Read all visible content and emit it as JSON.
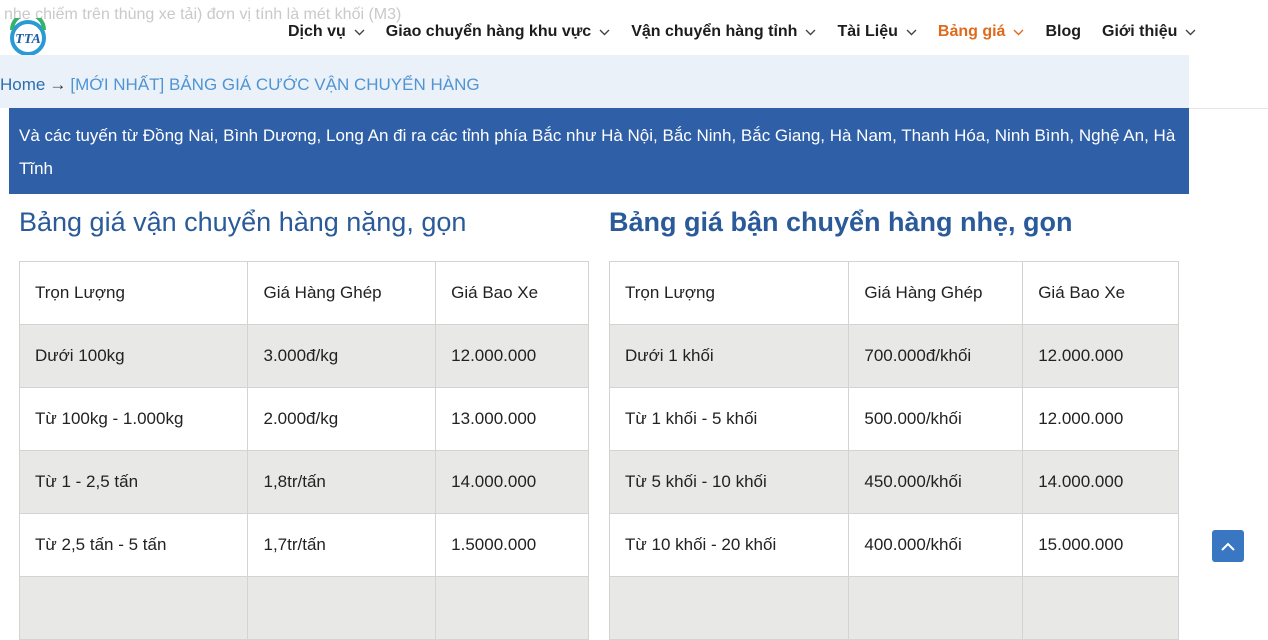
{
  "ghost_text": "nhe chiếm trên thùng xe tải) đơn vị tính là mét khối (M3)",
  "logo": {
    "text": "TTA"
  },
  "nav": [
    {
      "label": "Dịch vụ",
      "dropdown": true,
      "active": false
    },
    {
      "label": "Giao chuyển hàng khu vực",
      "dropdown": true,
      "active": false
    },
    {
      "label": "Vận chuyển hàng tỉnh",
      "dropdown": true,
      "active": false
    },
    {
      "label": "Tài Liệu",
      "dropdown": true,
      "active": false
    },
    {
      "label": "Bảng giá",
      "dropdown": true,
      "active": true
    },
    {
      "label": "Blog",
      "dropdown": false,
      "active": false
    },
    {
      "label": "Giới thiệu",
      "dropdown": true,
      "active": false
    }
  ],
  "breadcrumb": {
    "home": "Home",
    "separator": "→",
    "current": "[MỚI NHẤT] BẢNG GIÁ CƯỚC VẬN CHUYỂN HÀNG"
  },
  "banner": {
    "text": "Và các tuyến từ Đồng Nai, Bình Dương, Long An đi ra các tỉnh phía Bắc như Hà Nội, Bắc Ninh, Bắc Giang, Hà Nam, Thanh Hóa, Ninh Bình, Nghệ An, Hà Tĩnh"
  },
  "heavy": {
    "title": "Bảng giá vận chuyển hàng nặng, gọn",
    "headers": [
      "Trọn Lượng",
      "Giá Hàng Ghép",
      "Giá Bao Xe"
    ],
    "rows": [
      [
        "Dưới 100kg",
        "3.000đ/kg",
        "12.000.000"
      ],
      [
        "Từ 100kg - 1.000kg",
        "2.000đ/kg",
        "13.000.000"
      ],
      [
        "Từ 1 - 2,5 tấn",
        "1,8tr/tấn",
        "14.000.000"
      ],
      [
        "Từ 2,5 tấn - 5 tấn",
        "1,7tr/tấn",
        "1.5000.000"
      ]
    ]
  },
  "light": {
    "title": "Bảng giá bận chuyển hàng nhẹ, gọn",
    "headers": [
      "Trọn Lượng",
      "Giá Hàng Ghép",
      "Giá Bao Xe"
    ],
    "rows": [
      [
        "Dưới 1 khối",
        "700.000đ/khối",
        "12.000.000"
      ],
      [
        "Từ 1 khối - 5 khối",
        "500.000/khối",
        "12.000.000"
      ],
      [
        "Từ 5 khối - 10 khối",
        "450.000/khối",
        "14.000.000"
      ],
      [
        "Từ 10 khối - 20 khối",
        "400.000/khối",
        "15.000.000"
      ]
    ]
  },
  "colors": {
    "brand_blue": "#2f5fa7",
    "nav_active": "#e06a1b",
    "breadcrumb_bg": "#ebf1f8",
    "row_shade": "#e8e8e6"
  },
  "icons": {
    "logo": "tta-logo-icon",
    "dropdown": "chevron-down-icon",
    "back_to_top": "chevron-up-icon"
  }
}
